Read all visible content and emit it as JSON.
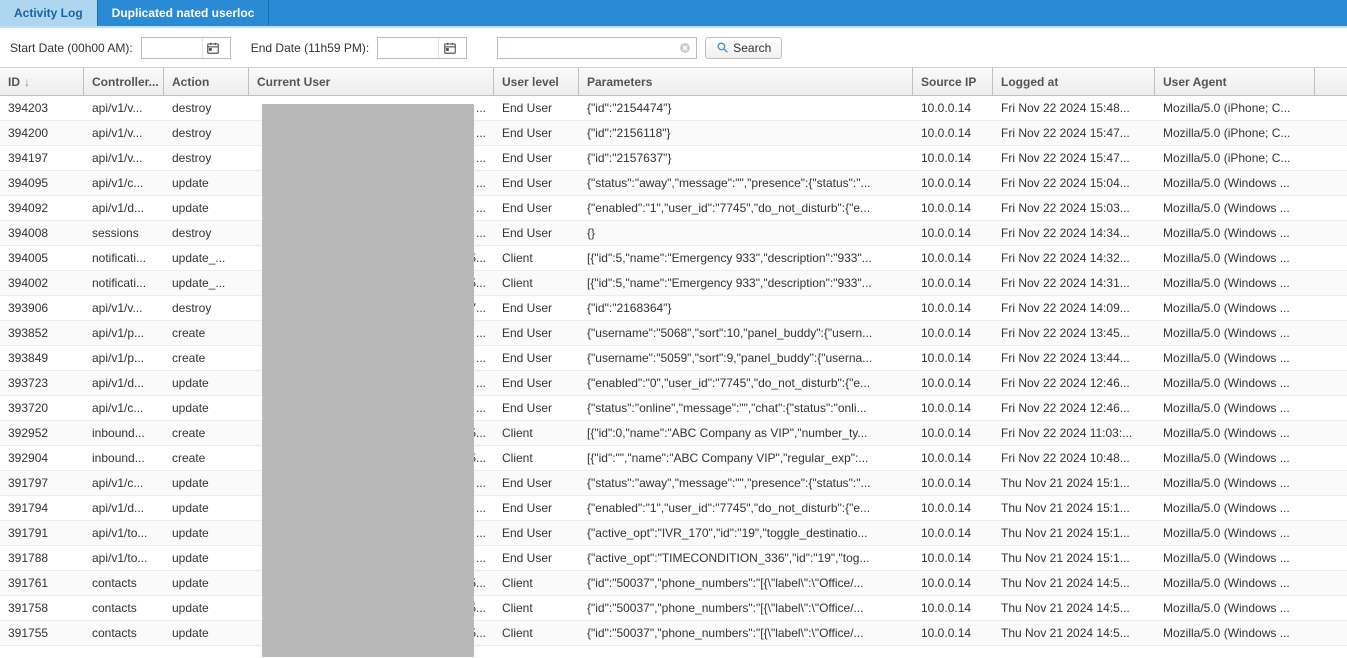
{
  "tabs": [
    {
      "label": "Activity Log",
      "active": true
    },
    {
      "label": "Duplicated nated userloc",
      "active": false
    }
  ],
  "toolbar": {
    "start_date_label": "Start Date (00h00 AM):",
    "end_date_label": "End Date (11h59 PM):",
    "search_button": "Search"
  },
  "columns": {
    "id": "ID",
    "controller": "Controller...",
    "action": "Action",
    "current_user": "Current User",
    "user_level": "User level",
    "parameters": "Parameters",
    "source_ip": "Source IP",
    "logged_at": "Logged at",
    "user_agent": "User Agent"
  },
  "rows": [
    {
      "id": "394203",
      "controller": "api/v1/v...",
      "action": "destroy",
      "user_suffix": "...",
      "level": "End User",
      "params": "{\"id\":\"2154474\"}",
      "ip": "10.0.0.14",
      "logged": "Fri Nov 22 2024 15:48...",
      "agent": "Mozilla/5.0 (iPhone; C..."
    },
    {
      "id": "394200",
      "controller": "api/v1/v...",
      "action": "destroy",
      "user_suffix": "...",
      "level": "End User",
      "params": "{\"id\":\"2156118\"}",
      "ip": "10.0.0.14",
      "logged": "Fri Nov 22 2024 15:47...",
      "agent": "Mozilla/5.0 (iPhone; C..."
    },
    {
      "id": "394197",
      "controller": "api/v1/v...",
      "action": "destroy",
      "user_suffix": "...",
      "level": "End User",
      "params": "{\"id\":\"2157637\"}",
      "ip": "10.0.0.14",
      "logged": "Fri Nov 22 2024 15:47...",
      "agent": "Mozilla/5.0 (iPhone; C..."
    },
    {
      "id": "394095",
      "controller": "api/v1/c...",
      "action": "update",
      "user_suffix": "...",
      "level": "End User",
      "params": "{\"status\":\"away\",\"message\":\"\",\"presence\":{\"status\":\"...",
      "ip": "10.0.0.14",
      "logged": "Fri Nov 22 2024 15:04...",
      "agent": "Mozilla/5.0 (Windows ..."
    },
    {
      "id": "394092",
      "controller": "api/v1/d...",
      "action": "update",
      "user_suffix": "...",
      "level": "End User",
      "params": "{\"enabled\":\"1\",\"user_id\":\"7745\",\"do_not_disturb\":{\"e...",
      "ip": "10.0.0.14",
      "logged": "Fri Nov 22 2024 15:03...",
      "agent": "Mozilla/5.0 (Windows ..."
    },
    {
      "id": "394008",
      "controller": "sessions",
      "action": "destroy",
      "user_suffix": "...",
      "level": "End User",
      "params": "{}",
      "ip": "10.0.0.14",
      "logged": "Fri Nov 22 2024 14:34...",
      "agent": "Mozilla/5.0 (Windows ..."
    },
    {
      "id": "394005",
      "controller": "notificati...",
      "action": "update_...",
      "user_suffix": "5...",
      "level": "Client",
      "params": "[{\"id\":5,\"name\":\"Emergency 933\",\"description\":\"933\"...",
      "ip": "10.0.0.14",
      "logged": "Fri Nov 22 2024 14:32...",
      "agent": "Mozilla/5.0 (Windows ..."
    },
    {
      "id": "394002",
      "controller": "notificati...",
      "action": "update_...",
      "user_suffix": "5...",
      "level": "Client",
      "params": "[{\"id\":5,\"name\":\"Emergency 933\",\"description\":\"933\"...",
      "ip": "10.0.0.14",
      "logged": "Fri Nov 22 2024 14:31...",
      "agent": "Mozilla/5.0 (Windows ..."
    },
    {
      "id": "393906",
      "controller": "api/v1/v...",
      "action": "destroy",
      "user_suffix": "7...",
      "level": "End User",
      "params": "{\"id\":\"2168364\"}",
      "ip": "10.0.0.14",
      "logged": "Fri Nov 22 2024 14:09...",
      "agent": "Mozilla/5.0 (Windows ..."
    },
    {
      "id": "393852",
      "controller": "api/v1/p...",
      "action": "create",
      "user_suffix": "...",
      "level": "End User",
      "params": "{\"username\":\"5068\",\"sort\":10,\"panel_buddy\":{\"usern...",
      "ip": "10.0.0.14",
      "logged": "Fri Nov 22 2024 13:45...",
      "agent": "Mozilla/5.0 (Windows ..."
    },
    {
      "id": "393849",
      "controller": "api/v1/p...",
      "action": "create",
      "user_suffix": "...",
      "level": "End User",
      "params": "{\"username\":\"5059\",\"sort\":9,\"panel_buddy\":{\"userna...",
      "ip": "10.0.0.14",
      "logged": "Fri Nov 22 2024 13:44...",
      "agent": "Mozilla/5.0 (Windows ..."
    },
    {
      "id": "393723",
      "controller": "api/v1/d...",
      "action": "update",
      "user_suffix": "...",
      "level": "End User",
      "params": "{\"enabled\":\"0\",\"user_id\":\"7745\",\"do_not_disturb\":{\"e...",
      "ip": "10.0.0.14",
      "logged": "Fri Nov 22 2024 12:46...",
      "agent": "Mozilla/5.0 (Windows ..."
    },
    {
      "id": "393720",
      "controller": "api/v1/c...",
      "action": "update",
      "user_suffix": "...",
      "level": "End User",
      "params": "{\"status\":\"online\",\"message\":\"\",\"chat\":{\"status\":\"onli...",
      "ip": "10.0.0.14",
      "logged": "Fri Nov 22 2024 12:46...",
      "agent": "Mozilla/5.0 (Windows ..."
    },
    {
      "id": "392952",
      "controller": "inbound...",
      "action": "create",
      "user_suffix": "5...",
      "level": "Client",
      "params": "[{\"id\":0,\"name\":\"ABC Company as VIP\",\"number_ty...",
      "ip": "10.0.0.14",
      "logged": "Fri Nov 22 2024 11:03:...",
      "agent": "Mozilla/5.0 (Windows ..."
    },
    {
      "id": "392904",
      "controller": "inbound...",
      "action": "create",
      "user_suffix": "5...",
      "level": "Client",
      "params": "[{\"id\":\"\",\"name\":\"ABC Company VIP\",\"regular_exp\":...",
      "ip": "10.0.0.14",
      "logged": "Fri Nov 22 2024 10:48...",
      "agent": "Mozilla/5.0 (Windows ..."
    },
    {
      "id": "391797",
      "controller": "api/v1/c...",
      "action": "update",
      "user_suffix": "...",
      "level": "End User",
      "params": "{\"status\":\"away\",\"message\":\"\",\"presence\":{\"status\":\"...",
      "ip": "10.0.0.14",
      "logged": "Thu Nov 21 2024 15:1...",
      "agent": "Mozilla/5.0 (Windows ..."
    },
    {
      "id": "391794",
      "controller": "api/v1/d...",
      "action": "update",
      "user_suffix": "...",
      "level": "End User",
      "params": "{\"enabled\":\"1\",\"user_id\":\"7745\",\"do_not_disturb\":{\"e...",
      "ip": "10.0.0.14",
      "logged": "Thu Nov 21 2024 15:1...",
      "agent": "Mozilla/5.0 (Windows ..."
    },
    {
      "id": "391791",
      "controller": "api/v1/to...",
      "action": "update",
      "user_suffix": "...",
      "level": "End User",
      "params": "{\"active_opt\":\"IVR_170\",\"id\":\"19\",\"toggle_destinatio...",
      "ip": "10.0.0.14",
      "logged": "Thu Nov 21 2024 15:1...",
      "agent": "Mozilla/5.0 (Windows ..."
    },
    {
      "id": "391788",
      "controller": "api/v1/to...",
      "action": "update",
      "user_suffix": "...",
      "level": "End User",
      "params": "{\"active_opt\":\"TIMECONDITION_336\",\"id\":\"19\",\"tog...",
      "ip": "10.0.0.14",
      "logged": "Thu Nov 21 2024 15:1...",
      "agent": "Mozilla/5.0 (Windows ..."
    },
    {
      "id": "391761",
      "controller": "contacts",
      "action": "update",
      "user_suffix": "5...",
      "level": "Client",
      "params": "{\"id\":\"50037\",\"phone_numbers\":\"[{\\\"label\\\":\\\"Office/...",
      "ip": "10.0.0.14",
      "logged": "Thu Nov 21 2024 14:5...",
      "agent": "Mozilla/5.0 (Windows ..."
    },
    {
      "id": "391758",
      "controller": "contacts",
      "action": "update",
      "user_suffix": "5...",
      "level": "Client",
      "params": "{\"id\":\"50037\",\"phone_numbers\":\"[{\\\"label\\\":\\\"Office/...",
      "ip": "10.0.0.14",
      "logged": "Thu Nov 21 2024 14:5...",
      "agent": "Mozilla/5.0 (Windows ..."
    },
    {
      "id": "391755",
      "controller": "contacts",
      "action": "update",
      "user_suffix": "5...",
      "level": "Client",
      "params": "{\"id\":\"50037\",\"phone_numbers\":\"[{\\\"label\\\":\\\"Office/...",
      "ip": "10.0.0.14",
      "logged": "Thu Nov 21 2024 14:5...",
      "agent": "Mozilla/5.0 (Windows ..."
    }
  ]
}
